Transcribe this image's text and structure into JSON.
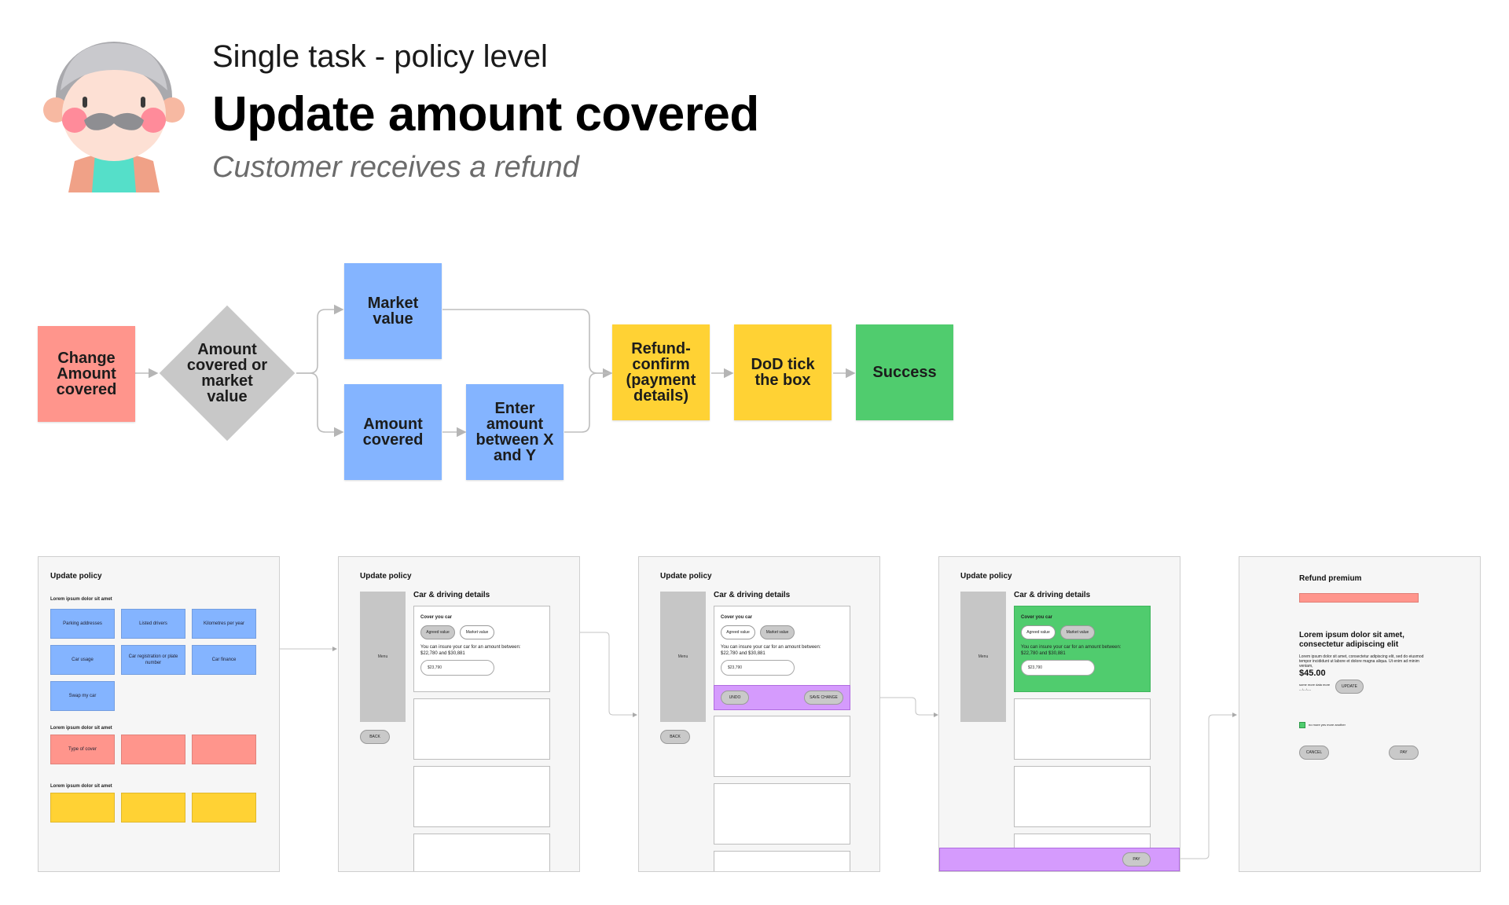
{
  "header": {
    "kicker": "Single task - policy level",
    "title": "Update amount covered",
    "subtitle": "Customer receives a refund"
  },
  "flow": {
    "start": "Change Amount covered",
    "decision": "Amount covered or market value",
    "market_value": "Market value",
    "amount_covered": "Amount covered",
    "enter_amount": "Enter amount between X and Y",
    "refund_confirm": "Refund-confirm (payment details)",
    "dod": "DoD tick the box",
    "success": "Success"
  },
  "colors": {
    "red": "#ff958c",
    "blue": "#84b4ff",
    "yellow": "#ffd234",
    "green": "#50cc6e",
    "grey": "#c8c8c8",
    "purple": "#d59bfd"
  },
  "screens": {
    "s1": {
      "title": "Update policy",
      "section1": "Lorem ipsum dolor sit amet",
      "tiles": [
        "Parking addresses",
        "Listed drivers",
        "Kilometres per year",
        "Car usage",
        "Car registration or plate number",
        "Car finance",
        "Swap my car"
      ],
      "section2": "Lorem ipsum dolor sit amet",
      "cover_tile": "Type of cover",
      "section3": "Lorem ipsum dolor sit amet"
    },
    "edit": {
      "title": "Update policy",
      "section": "Car & driving details",
      "menu": "Menu",
      "cover_label": "Cover you car",
      "agreed": "Agreed value",
      "market": "Market value",
      "hint": "You can insure your car for an amount between: $22,780 and $30,881",
      "amount": "$23,790",
      "back": "BACK",
      "undo": "UNDO",
      "save": "SAVE CHANGE",
      "pay": "PAY"
    },
    "refund": {
      "title": "Refund premium",
      "heading": "Lorem ipsum dolor sit amet, consectetur adipiscing elit",
      "body": "Lorem ipsum dolor sit amet, consectetur adipiscing elit, sed do eiusmod tempor incididunt ut labore et dolore magna aliqua. Ut enim ad minim veniam,",
      "price": "$45.00",
      "price_note": "some more data more",
      "price_note2": "-- /-- /----",
      "update": "UPDATE",
      "checkbox_label": "no more yes more another",
      "cancel": "CANCEL",
      "pay": "PAY"
    }
  }
}
